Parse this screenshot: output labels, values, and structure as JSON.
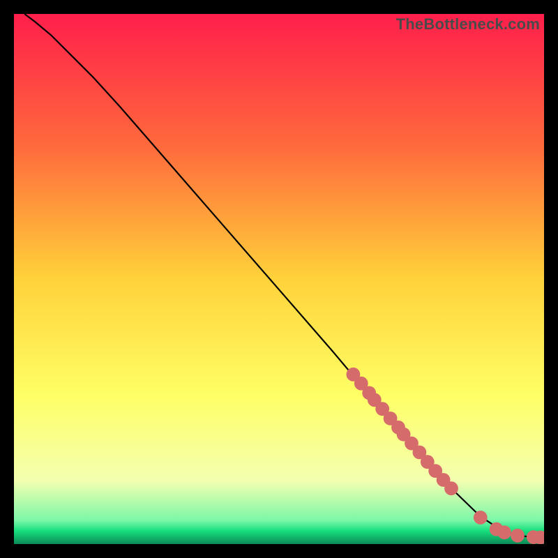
{
  "watermark": "TheBottleneck.com",
  "chart_data": {
    "type": "line",
    "title": "",
    "xlabel": "",
    "ylabel": "",
    "xlim": [
      0,
      100
    ],
    "ylim": [
      0,
      100
    ],
    "grid": false,
    "legend": false,
    "background_gradient": {
      "stops": [
        {
          "offset": 0.0,
          "color": "#ff1f4b"
        },
        {
          "offset": 0.25,
          "color": "#ff6a3c"
        },
        {
          "offset": 0.5,
          "color": "#ffd23a"
        },
        {
          "offset": 0.72,
          "color": "#ffff66"
        },
        {
          "offset": 0.88,
          "color": "#f4ffb0"
        },
        {
          "offset": 0.955,
          "color": "#7cf7a8"
        },
        {
          "offset": 0.975,
          "color": "#17e07e"
        },
        {
          "offset": 1.0,
          "color": "#0a8a57"
        }
      ]
    },
    "curve": {
      "x": [
        2,
        4,
        7,
        10,
        15,
        20,
        30,
        40,
        50,
        60,
        68,
        75,
        82,
        88,
        92,
        95,
        98,
        100
      ],
      "y": [
        100,
        98.5,
        96,
        93,
        88,
        82.5,
        71,
        59.5,
        48,
        36.5,
        27,
        19,
        11,
        5.2,
        2.6,
        1.6,
        1.3,
        1.2
      ]
    },
    "markers": {
      "color": "#d66b6b",
      "radius_rel": 0.013,
      "points": [
        {
          "x": 64,
          "y": 32
        },
        {
          "x": 65.5,
          "y": 30.3
        },
        {
          "x": 67,
          "y": 28.5
        },
        {
          "x": 68,
          "y": 27.2
        },
        {
          "x": 69.5,
          "y": 25.5
        },
        {
          "x": 71,
          "y": 23.7
        },
        {
          "x": 72.5,
          "y": 22
        },
        {
          "x": 73.5,
          "y": 20.7
        },
        {
          "x": 75,
          "y": 19
        },
        {
          "x": 76.5,
          "y": 17.3
        },
        {
          "x": 78,
          "y": 15.5
        },
        {
          "x": 79.5,
          "y": 13.8
        },
        {
          "x": 81,
          "y": 12.1
        },
        {
          "x": 82.5,
          "y": 10.5
        },
        {
          "x": 88,
          "y": 5.0
        },
        {
          "x": 91,
          "y": 2.8
        },
        {
          "x": 92.5,
          "y": 2.2
        },
        {
          "x": 95,
          "y": 1.6
        },
        {
          "x": 98,
          "y": 1.3
        },
        {
          "x": 99.3,
          "y": 1.25
        }
      ]
    }
  }
}
